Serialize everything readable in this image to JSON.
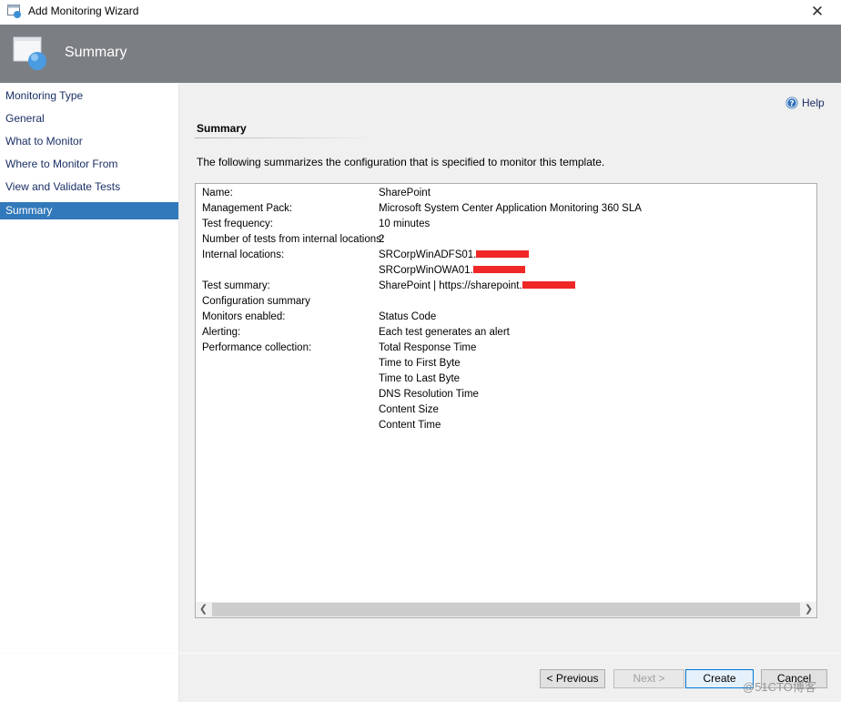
{
  "window": {
    "title": "Add Monitoring Wizard",
    "close_glyph": "✕"
  },
  "header": {
    "title": "Summary"
  },
  "nav": {
    "items": [
      {
        "label": "Monitoring Type"
      },
      {
        "label": "General"
      },
      {
        "label": "What to Monitor"
      },
      {
        "label": "Where to Monitor From"
      },
      {
        "label": "View and Validate Tests"
      },
      {
        "label": "Summary",
        "selected": true
      }
    ]
  },
  "content": {
    "help_label": "Help",
    "section_title": "Summary",
    "intro": "The following summarizes the configuration that is specified to monitor this template.",
    "summary": {
      "name_label": "Name:",
      "name_value": "SharePoint",
      "mp_label": "Management Pack:",
      "mp_value": "Microsoft System Center Application Monitoring 360 SLA",
      "freq_label": "Test frequency:",
      "freq_value": "10 minutes",
      "count_label": "Number of tests from internal locations:",
      "count_value": "2",
      "locations_label": "Internal locations:",
      "location_1": "SRCorpWinADFS01.",
      "location_2": "SRCorpWinOWA01.",
      "test_summary_label": "Test summary:",
      "test_summary_value": "SharePoint | https://sharepoint.",
      "config_summary_label": "Configuration summary",
      "monitors_label": "Monitors enabled:",
      "monitors_value": "Status Code",
      "alerting_label": "Alerting:",
      "alerting_value": "Each test generates an alert",
      "perf_label": "Performance collection:",
      "perf_values": [
        "Total Response Time",
        "Time to First Byte",
        "Time to Last Byte",
        "DNS Resolution Time",
        "Content Size",
        "Content Time"
      ]
    },
    "redaction_color": "#ef2727"
  },
  "buttons": {
    "previous": "< Previous",
    "next": "Next >",
    "create": "Create",
    "cancel": "Cancel"
  },
  "watermark": "@51CTO博客"
}
